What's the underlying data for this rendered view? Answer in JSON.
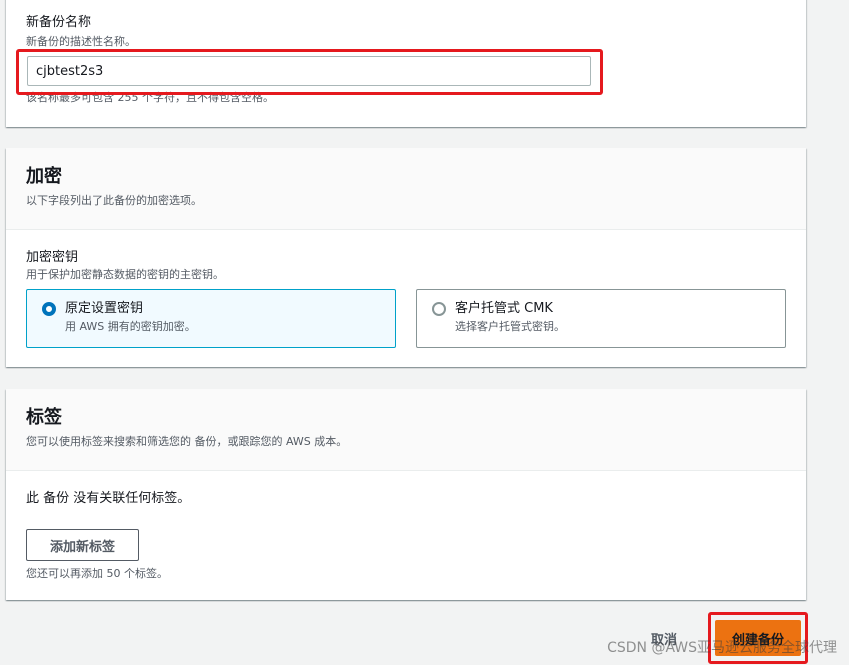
{
  "backup_name": {
    "label": "新备份名称",
    "description": "新备份的描述性名称。",
    "value": "cjbtest2s3",
    "constraint": "该名称最多可包含 255 个字符，且不得包含空格。"
  },
  "encryption": {
    "title": "加密",
    "description": "以下字段列出了此备份的加密选项。",
    "key_label": "加密密钥",
    "key_description": "用于保护加密静态数据的密钥的主密钥。",
    "options": [
      {
        "title": "原定设置密钥",
        "description": "用 AWS 拥有的密钥加密。",
        "selected": true
      },
      {
        "title": "客户托管式 CMK",
        "description": "选择客户托管式密钥。",
        "selected": false
      }
    ]
  },
  "tags": {
    "title": "标签",
    "description": "您可以使用标签来搜索和筛选您的 备份，或跟踪您的 AWS 成本。",
    "empty_text": "此 备份 没有关联任何标签。",
    "add_button": "添加新标签",
    "limit_text": "您还可以再添加 50 个标签。"
  },
  "actions": {
    "cancel": "取消",
    "create": "创建备份"
  },
  "watermark": "CSDN @AWS亚马逊云服务全球代理",
  "colors": {
    "primary": "#ec7211",
    "selected_border": "#00a1c9",
    "radio_selected": "#0073bb",
    "highlight": "#e5191e"
  }
}
